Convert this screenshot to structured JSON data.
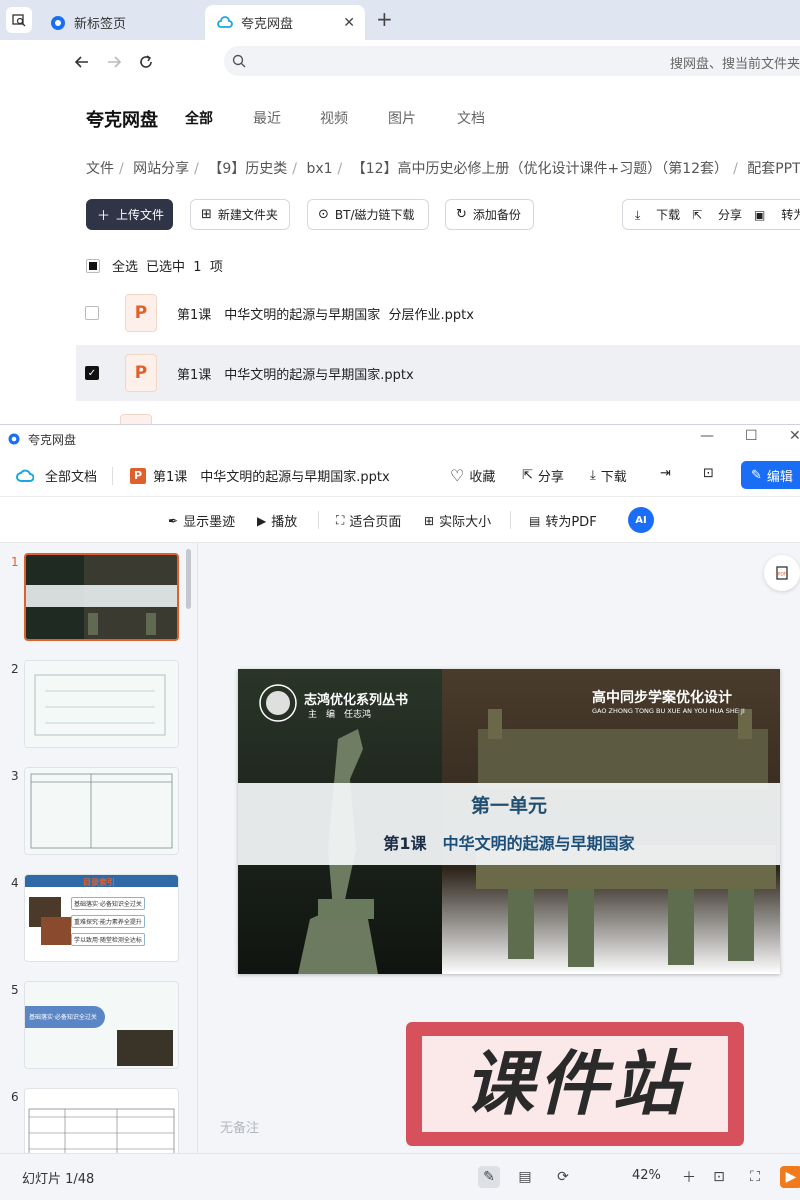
{
  "browser": {
    "tabs": [
      {
        "label": "新标签页",
        "icon": "browser-logo-icon"
      },
      {
        "label": "夸克网盘",
        "icon": "quark-cloud-icon",
        "active": true
      }
    ],
    "add_tab": "+",
    "omnibox_placeholder": "搜网盘、搜当前文件夹"
  },
  "drive": {
    "brand": "夸克网盘",
    "nav": [
      "全部",
      "最近",
      "视频",
      "图片",
      "文档"
    ],
    "breadcrumb": [
      "文件",
      "网站分享",
      "【9】历史类",
      "bx1",
      "【12】高中历史必修上册（优化设计课件+习题）（第12套）",
      "配套PPT课"
    ],
    "toolbar": {
      "upload": "上传文件",
      "new_folder": "新建文件夹",
      "bt": "BT/磁力链下载",
      "backup": "添加备份",
      "download": "下载",
      "share": "分享",
      "convert": "转为"
    },
    "select_all": "全选",
    "selected_text": "已选中  1  项",
    "files": [
      {
        "name": "第1课　中华文明的起源与早期国家  分层作业.pptx",
        "checked": false
      },
      {
        "name": "第1课　中华文明的起源与早期国家.pptx",
        "checked": true
      }
    ]
  },
  "preview": {
    "window_title": "夸克网盘",
    "all_docs": "全部文档",
    "doc_title": "第1课　中华文明的起源与早期国家.pptx",
    "actions": {
      "favorite": "收藏",
      "share": "分享",
      "download": "下载",
      "edit": "编辑"
    },
    "sub_toolbar": {
      "ink": "显示墨迹",
      "play": "播放",
      "fit": "适合页面",
      "actual": "实际大小",
      "to_pdf": "转为PDF",
      "ai": "AI"
    },
    "thumbnails": [
      "1",
      "2",
      "3",
      "4",
      "5",
      "6"
    ],
    "active_thumb": 1,
    "notes": "无备注",
    "slide_count": "幻灯片 1/48",
    "zoom": "42%"
  },
  "slide": {
    "series": "志鸿优化系列丛书",
    "editor": "主　编　任志鸿",
    "heading": "高中同步学案优化设计",
    "pinyin": "GAO ZHONG TONG BU XUE AN YOU HUA SHE JI",
    "unit": "第一单元",
    "lesson_no": "第1课",
    "lesson_title": "中华文明的起源与早期国家"
  },
  "thumb_texts": {
    "t4_title": "目录索引",
    "t4_items": [
      "基础落实·必备知识全过关",
      "重难探究·能力素养全提升",
      "学以致用·随堂检测全达标"
    ],
    "t5_title": "基础落实·必备知识全过关"
  },
  "watermark": "课件站",
  "colors": {
    "accent": "#1a6ef5",
    "ppt": "#e0602c",
    "dark": "#2f3446",
    "stamp": "#d4424e"
  }
}
